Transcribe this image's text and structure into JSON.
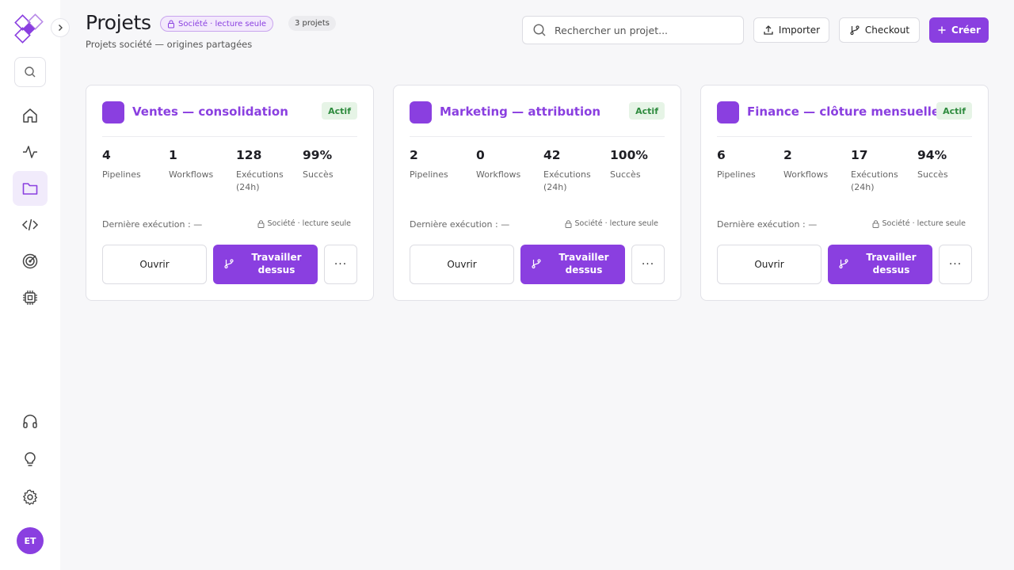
{
  "sidebar": {
    "collapse_icon": "chevron-right-icon",
    "nav": [
      {
        "name": "home",
        "icon": "home-icon"
      },
      {
        "name": "activity",
        "icon": "activity-icon"
      },
      {
        "name": "projects",
        "icon": "folder-icon",
        "active": true
      },
      {
        "name": "code",
        "icon": "code-icon"
      },
      {
        "name": "targets",
        "icon": "target-icon"
      },
      {
        "name": "compute",
        "icon": "cpu-icon"
      },
      {
        "name": "support",
        "icon": "headphones-icon"
      },
      {
        "name": "ideas",
        "icon": "lightbulb-icon"
      },
      {
        "name": "settings",
        "icon": "gear-icon"
      }
    ],
    "avatar_initials": "ET"
  },
  "header": {
    "title": "Projets",
    "readonly_badge": "Société · lecture seule",
    "count_badge": "3 projets",
    "subtitle": "Projets société — origines partagées",
    "search_placeholder": "Rechercher un projet...",
    "import_label": "Importer",
    "checkout_label": "Checkout",
    "create_label": "Créer"
  },
  "stat_labels": {
    "pipelines": "Pipelines",
    "workflows": "Workflows",
    "executions": "Exécutions (24h)",
    "success": "Succès"
  },
  "card_labels": {
    "last_run": "Dernière exécution : —",
    "lock": "Société · lecture seule",
    "open": "Ouvrir",
    "work": "Travailler dessus",
    "more": "···"
  },
  "projects": [
    {
      "name": "Ventes — consolidation",
      "status": "Actif",
      "pipelines": "4",
      "workflows": "1",
      "executions": "128",
      "success": "99%"
    },
    {
      "name": "Marketing — attribution",
      "status": "Actif",
      "pipelines": "2",
      "workflows": "0",
      "executions": "42",
      "success": "100%"
    },
    {
      "name": "Finance — clôture mensuelle",
      "status": "Actif",
      "pipelines": "6",
      "workflows": "2",
      "executions": "17",
      "success": "94%"
    }
  ],
  "colors": {
    "accent": "#8a3fe0",
    "status_bg": "#e6f4e6",
    "status_text": "#2e8b3e"
  }
}
